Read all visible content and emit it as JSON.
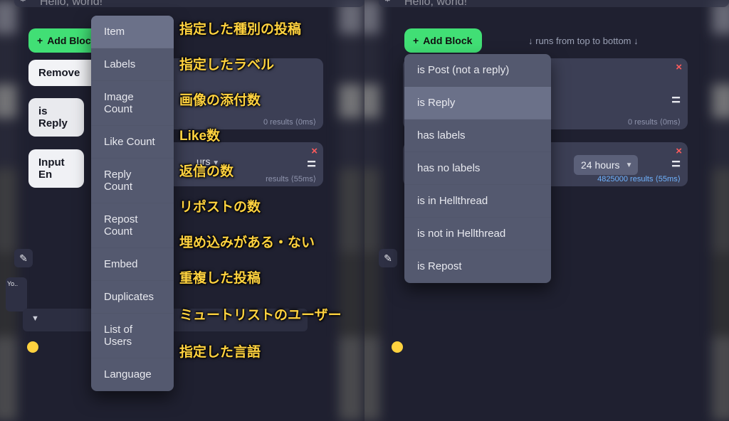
{
  "shared": {
    "add_block_label": "Add Block",
    "hello_text": "Hello, world!",
    "runs_hint": "↓ runs from top to bottom ↓"
  },
  "left": {
    "remove_label": "Remove",
    "is_reply_label": "is Reply",
    "input_label": "Input  En",
    "yo_label": "Yo..",
    "faint_urs": "urs",
    "results0": "0 results ⟨0ms⟩",
    "results1": "results ⟨55ms⟩",
    "menu_items": [
      "Item",
      "Labels",
      "Image Count",
      "Like Count",
      "Reply Count",
      "Repost Count",
      "Embed",
      "Duplicates",
      "List of Users",
      "Language"
    ],
    "annotations": [
      "指定した種別の投稿",
      "指定したラベル",
      "画像の添付数",
      "Like数",
      "返信の数",
      "リポストの数",
      "埋め込みがある・ない",
      "重複した投稿",
      "ミュートリストのユーザー",
      "指定した言語"
    ]
  },
  "right": {
    "block1_results": "0 results ⟨0ms⟩",
    "block2_label": "24 hours",
    "block2_results": "4825000 results ⟨55ms⟩",
    "menu_items": [
      "is Post (not a reply)",
      "is Reply",
      "has labels",
      "has no labels",
      "is in Hellthread",
      "is not in Hellthread",
      "is Repost"
    ]
  }
}
